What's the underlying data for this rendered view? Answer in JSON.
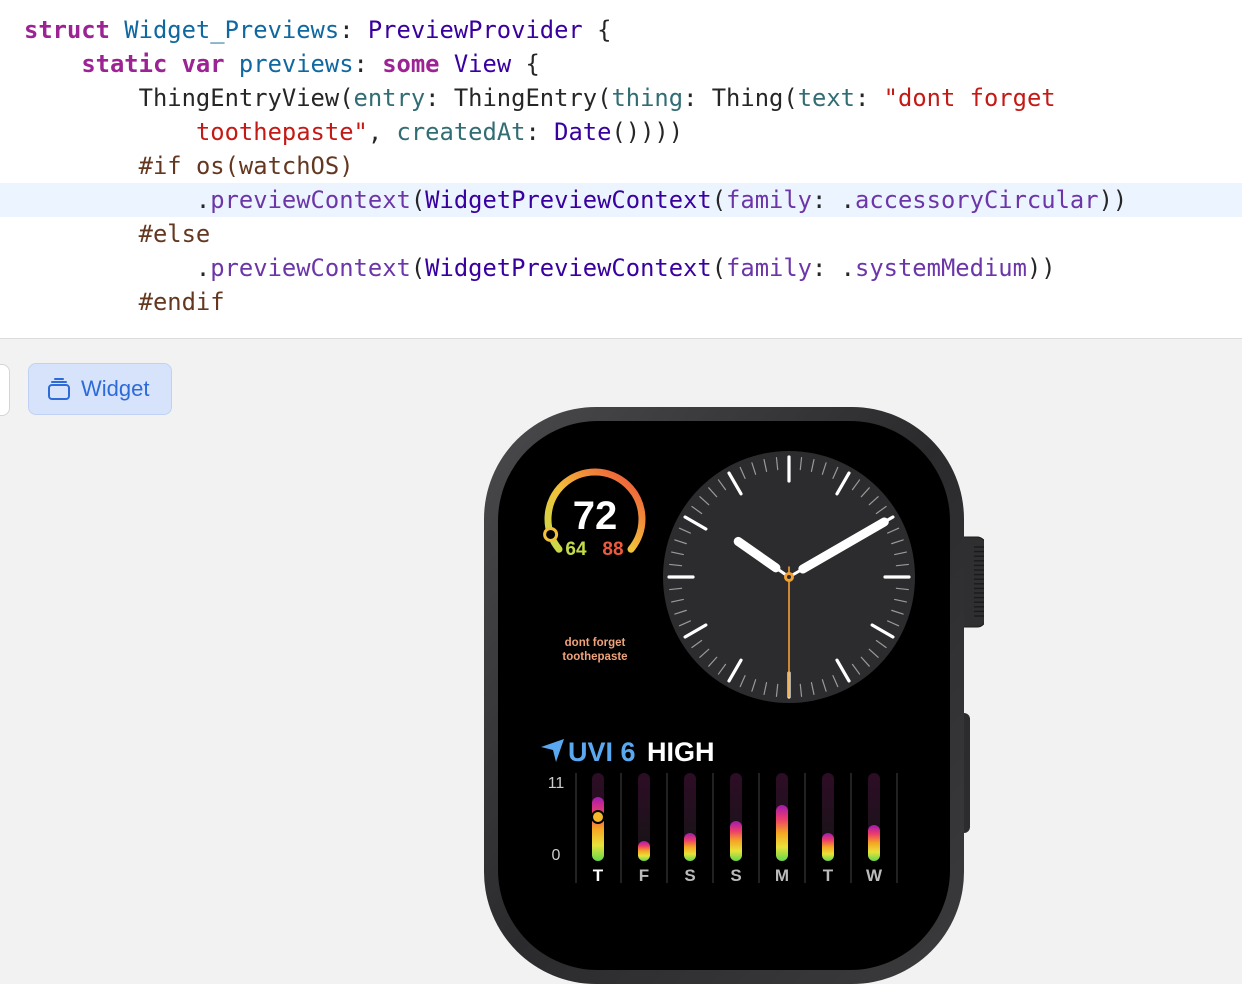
{
  "code": {
    "lines": [
      [
        {
          "t": "struct",
          "c": "kw"
        },
        {
          "t": " "
        },
        {
          "t": "Widget_Previews",
          "c": "decl"
        },
        {
          "t": ": "
        },
        {
          "t": "PreviewProvider",
          "c": "typ"
        },
        {
          "t": " {"
        }
      ],
      [
        {
          "t": "    "
        },
        {
          "t": "static",
          "c": "kw"
        },
        {
          "t": " "
        },
        {
          "t": "var",
          "c": "kw"
        },
        {
          "t": " "
        },
        {
          "t": "previews",
          "c": "decl"
        },
        {
          "t": ": "
        },
        {
          "t": "some",
          "c": "kw"
        },
        {
          "t": " "
        },
        {
          "t": "View",
          "c": "typ"
        },
        {
          "t": " {"
        }
      ],
      [
        {
          "t": "        ThingEntryView("
        },
        {
          "t": "entry",
          "c": "ufn"
        },
        {
          "t": ": ThingEntry("
        },
        {
          "t": "thing",
          "c": "ufn"
        },
        {
          "t": ": Thing("
        },
        {
          "t": "text",
          "c": "ufn"
        },
        {
          "t": ": "
        },
        {
          "t": "\"dont forget",
          "c": "str"
        }
      ],
      [
        {
          "t": "            "
        },
        {
          "t": "toothepaste\"",
          "c": "str"
        },
        {
          "t": ", "
        },
        {
          "t": "createdAt",
          "c": "ufn"
        },
        {
          "t": ": "
        },
        {
          "t": "Date",
          "c": "typ"
        },
        {
          "t": "())))"
        }
      ],
      [
        {
          "t": "        "
        },
        {
          "t": "#if",
          "c": "pre"
        },
        {
          "t": " "
        },
        {
          "t": "os(watchOS)",
          "c": "pre"
        }
      ],
      [
        {
          "t": "            ."
        },
        {
          "t": "previewContext",
          "c": "sym"
        },
        {
          "t": "("
        },
        {
          "t": "WidgetPreviewContext",
          "c": "typ"
        },
        {
          "t": "("
        },
        {
          "t": "family",
          "c": "sym"
        },
        {
          "t": ": ."
        },
        {
          "t": "accessoryCircular",
          "c": "sym"
        },
        {
          "t": "))"
        }
      ],
      [
        {
          "t": "        "
        },
        {
          "t": "#else",
          "c": "pre"
        }
      ],
      [
        {
          "t": "            ."
        },
        {
          "t": "previewContext",
          "c": "sym"
        },
        {
          "t": "("
        },
        {
          "t": "WidgetPreviewContext",
          "c": "typ"
        },
        {
          "t": "("
        },
        {
          "t": "family",
          "c": "sym"
        },
        {
          "t": ": ."
        },
        {
          "t": "systemMedium",
          "c": "sym"
        },
        {
          "t": "))"
        }
      ],
      [
        {
          "t": "        "
        },
        {
          "t": "#endif",
          "c": "pre"
        }
      ]
    ],
    "current_line": 5
  },
  "preview": {
    "widget_button_label": "Widget"
  },
  "watch": {
    "temperature": {
      "current": "72",
      "low": "64",
      "high": "88",
      "position": 0.08
    },
    "widget_text": "dont forget toothepaste",
    "widget_text_lines": [
      "dont forget",
      "toothepaste"
    ],
    "clock": {
      "hour": 10,
      "minute": 10,
      "second": 30
    },
    "uv": {
      "label": "UVI 6",
      "level": "HIGH",
      "axis_max": "11",
      "axis_min": "0",
      "max_value": 11,
      "days": [
        "T",
        "F",
        "S",
        "S",
        "M",
        "T",
        "W"
      ],
      "values": [
        8.0,
        2.5,
        3.5,
        5.0,
        7.0,
        3.5,
        4.5
      ],
      "current_day_index": 0,
      "current_value": 5.5
    },
    "colors": {
      "accent": "#f2a134",
      "uv_blue": "#5aa8f0",
      "low_temp": "#c5dc4a",
      "high_temp": "#ee5a3d",
      "note_text": "#f0a37a"
    }
  }
}
